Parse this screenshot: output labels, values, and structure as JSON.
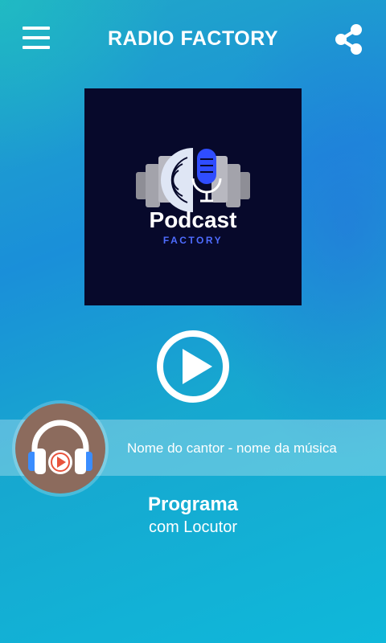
{
  "header": {
    "title": "RADIO FACTORY",
    "menu_icon": "hamburger-menu-icon",
    "share_icon": "share-icon"
  },
  "cover": {
    "title": "Podcast",
    "subtitle": "FACTORY",
    "accent_color": "#3b5bff"
  },
  "player": {
    "play_icon": "play-icon",
    "now_playing": "Nome do cantor - nome da música",
    "avatar_icon": "headphones-play-icon"
  },
  "program": {
    "name": "Programa",
    "host": "com Locutor"
  }
}
